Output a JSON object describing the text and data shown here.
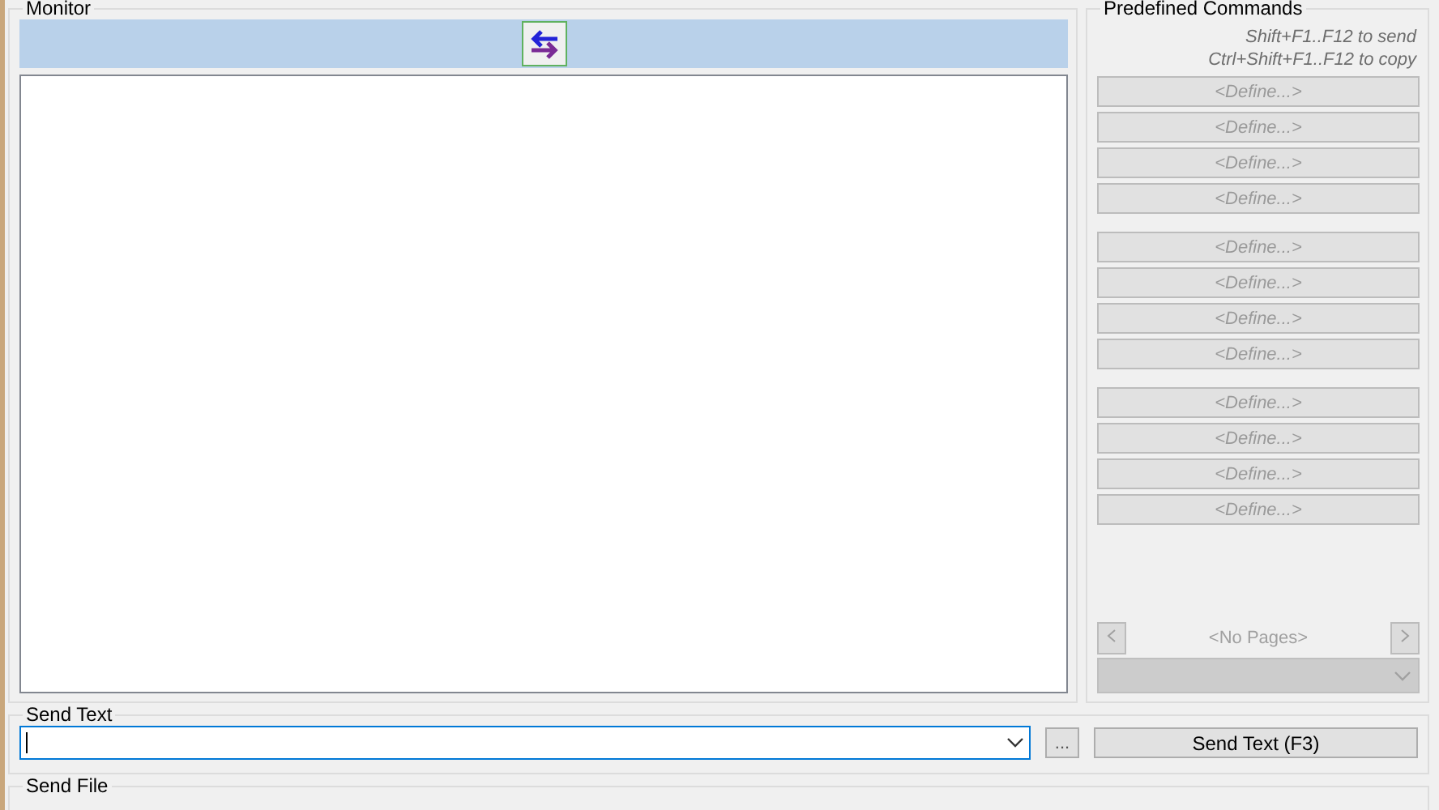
{
  "monitor": {
    "title": "Monitor"
  },
  "predefined": {
    "title": "Predefined Commands",
    "hints": [
      "Shift+F1..F12  to send",
      "Ctrl+Shift+F1..F12  to copy"
    ],
    "groups": [
      {
        "commands": [
          {
            "label": "<Define...>",
            "disabled": true
          },
          {
            "label": "<Define...>",
            "disabled": true
          },
          {
            "label": "<Define...>",
            "disabled": true
          },
          {
            "label": "<Define...>",
            "disabled": true
          }
        ]
      },
      {
        "commands": [
          {
            "label": "<Define...>",
            "disabled": true
          },
          {
            "label": "<Define...>",
            "disabled": true
          },
          {
            "label": "<Define...>",
            "disabled": true
          },
          {
            "label": "<Define...>",
            "disabled": true
          }
        ]
      },
      {
        "commands": [
          {
            "label": "<Define...>",
            "disabled": true
          },
          {
            "label": "<Define...>",
            "disabled": true
          },
          {
            "label": "<Define...>",
            "disabled": true
          },
          {
            "label": "<Define...>",
            "disabled": true
          }
        ]
      }
    ],
    "pager": {
      "label": "<No Pages>",
      "prev_disabled": true,
      "next_disabled": true,
      "select_disabled": true
    }
  },
  "send_text": {
    "title": "Send Text",
    "browse": "...",
    "button": "Send Text (F3)",
    "focused": true
  },
  "send_file": {
    "title": "Send File"
  }
}
